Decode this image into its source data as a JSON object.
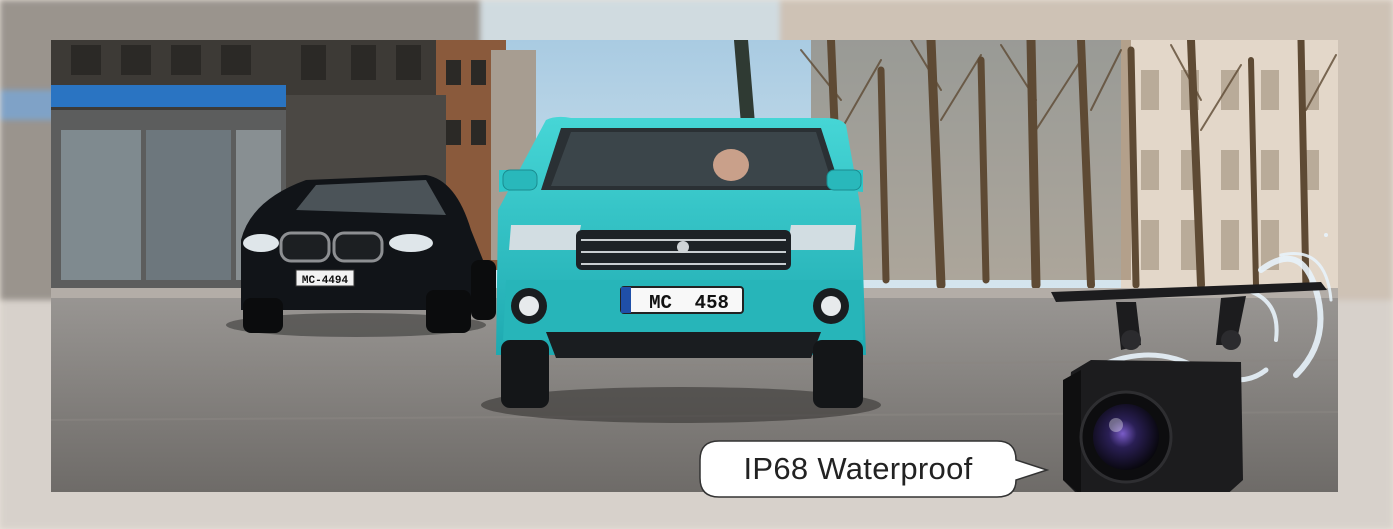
{
  "callout": {
    "text": "IP68 Waterproof"
  },
  "plates": {
    "front_car": "MC  458",
    "rear_car": "MC-4494"
  },
  "colors": {
    "background": "#e9e2da",
    "suv_body": "#2fc7c9",
    "bmw_body": "#111418",
    "sky": "#bcd6e6",
    "road": "#7c7a78",
    "camera_body": "#1c1c1e"
  },
  "icons": {
    "camera": "backup-camera-icon",
    "water": "water-splash-icon"
  }
}
